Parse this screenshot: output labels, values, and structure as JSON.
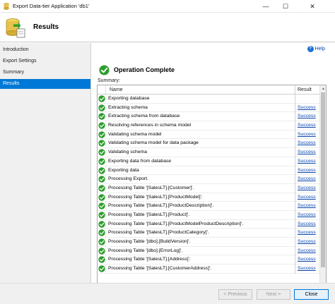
{
  "window": {
    "title": "Export Data-tier Application 'db1'",
    "controls": {
      "minimize": "—",
      "maximize": "☐",
      "close": "✕"
    }
  },
  "header": {
    "title": "Results"
  },
  "sidebar": {
    "items": [
      {
        "label": "Introduction",
        "active": false
      },
      {
        "label": "Export Settings",
        "active": false
      },
      {
        "label": "Summary",
        "active": false
      },
      {
        "label": "Results",
        "active": true
      }
    ]
  },
  "help": {
    "label": "Help"
  },
  "operation": {
    "title": "Operation Complete"
  },
  "summary": {
    "label": "Summary:",
    "columns": {
      "name": "Name",
      "result": "Result"
    },
    "rows": [
      {
        "name": "Exporting database",
        "result": ""
      },
      {
        "name": "Extracting schema",
        "result": "Success"
      },
      {
        "name": "Extracting schema from database",
        "result": "Success"
      },
      {
        "name": "Resolving references in schema model",
        "result": "Success"
      },
      {
        "name": "Validating schema model",
        "result": "Success"
      },
      {
        "name": "Validating schema model for data package",
        "result": "Success"
      },
      {
        "name": "Validating schema",
        "result": "Success"
      },
      {
        "name": "Exporting data from database",
        "result": "Success"
      },
      {
        "name": "Exporting data",
        "result": "Success"
      },
      {
        "name": "Processing Export.",
        "result": "Success"
      },
      {
        "name": "Processing Table '[SalesLT].[Customer]'.",
        "result": "Success"
      },
      {
        "name": "Processing Table '[SalesLT].[ProductModel]'.",
        "result": "Success"
      },
      {
        "name": "Processing Table '[SalesLT].[ProductDescription]'.",
        "result": "Success"
      },
      {
        "name": "Processing Table '[SalesLT].[Product]'.",
        "result": "Success"
      },
      {
        "name": "Processing Table '[SalesLT].[ProductModelProductDescription]'.",
        "result": "Success"
      },
      {
        "name": "Processing Table '[SalesLT].[ProductCategory]'.",
        "result": "Success"
      },
      {
        "name": "Processing Table '[dbo].[BuildVersion]'.",
        "result": "Success"
      },
      {
        "name": "Processing Table '[dbo].[ErrorLog]'.",
        "result": "Success"
      },
      {
        "name": "Processing Table '[SalesLT].[Address]'.",
        "result": "Success"
      },
      {
        "name": "Processing Table '[SalesLT].[CustomerAddress]'.",
        "result": "Success"
      }
    ]
  },
  "buttons": {
    "previous": "< Previous",
    "next": "Next >",
    "close": "Close"
  },
  "colors": {
    "accent": "#0078d7",
    "success_green": "#2e9e2e",
    "link": "#0645ad"
  }
}
